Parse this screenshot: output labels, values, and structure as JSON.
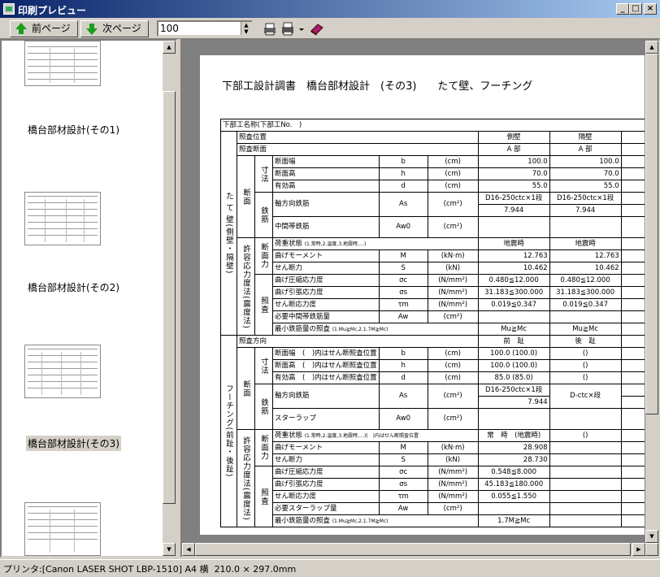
{
  "window": {
    "title": "印刷プレビュー",
    "min": "_",
    "max": "□",
    "close": "×"
  },
  "toolbar": {
    "prev_label": "前ページ",
    "next_label": "次ページ",
    "zoom_value": "100"
  },
  "thumbnails": [
    {
      "label": "橋台部材設計(その1)"
    },
    {
      "label": "橋台部材設計(その2)"
    },
    {
      "label": "橋台部材設計(その3)"
    }
  ],
  "page": {
    "title": "下部工設計調書　橋台部材設計　(その3)　　たて壁、フーチング",
    "header_name": "下部工名称(下部工No.　)",
    "wall_label": "た て 壁",
    "wall_sub": "(側壁・隔壁)",
    "footing_label": "フーチング",
    "footing_sub": "(前趾・後趾)",
    "dansen": "断面",
    "check": "許容応力度法(震度法)",
    "sunpo": "寸法",
    "tekkin": "鉄筋",
    "danmen_ryoku": "断面力",
    "shosa": "照査",
    "rows": {
      "pos": "照査位置",
      "sect": "照査断面",
      "side": "側壁",
      "partition": "隔壁",
      "a_bu": "A 部",
      "width": "断面幅",
      "height": "断面高",
      "eff": "有効高",
      "axial": "軸方向鉄筋",
      "mid": "中間帯鉄筋",
      "load": "荷重状態",
      "load_note": "(1.常時,2.温度,3.地震時,…)",
      "moment": "曲げモーメント",
      "shear": "せん断力",
      "comp": "曲げ圧縮応力度",
      "tens": "曲げ引張応力度",
      "shear_stress": "せん断応力度",
      "req_mid": "必要中間帯鉄筋量",
      "min_check": "最小鉄筋量の照査",
      "min_note": "(1.Mu≧Mc,2.1.7M≧Mc)",
      "dir": "照査方向",
      "front": "前　趾",
      "rear": "後　趾",
      "fw": "断面幅　(　)内はせん断照査位置",
      "fh": "断面高　(　)内はせん断照査位置",
      "fe": "有効高　(　)内はせん断照査位置",
      "stirrup": "スターラップ",
      "req_stirrup": "必要スターラップ量",
      "fload": "荷重状態",
      "fload_note": "(1.常時,2.温度,3.地震時,…)(　)内はせん断照査位置"
    },
    "sym": {
      "b": "b",
      "h": "h",
      "d": "d",
      "As": "As",
      "Aw0": "Aw0",
      "M": "M",
      "S": "S",
      "sc": "σc",
      "ss": "σs",
      "tm": "τm",
      "Aw": "Aw"
    },
    "unit": {
      "cm": "(cm)",
      "cm2": "(cm²)",
      "kNm": "(kN·m)",
      "kN": "(kN)",
      "nmm": "(N/mm²)"
    },
    "vals": {
      "w1": "100.0",
      "w2": "100.0",
      "h1": "70.0",
      "h2": "70.0",
      "d1": "55.0",
      "d2": "55.0",
      "as1": "D16-250ctc×1段",
      "as1b": "7.944",
      "as2": "D16-250ctc×1段",
      "as2b": "7.944",
      "l1": "地震時",
      "l2": "地震時",
      "m1": "12.763",
      "m2": "12.763",
      "s1": "10.462",
      "s2": "10.462",
      "c1": "0.480≦12.000",
      "c2": "0.480≦12.000",
      "t1": "31.183≦300.000",
      "t2": "31.183≦300.000",
      "tau1": "0.019≦0.347",
      "tau2": "0.019≦0.347",
      "mc1": "Mu≧Mc",
      "mc2": "Mu≧Mc",
      "fw1": "100.0 (100.0)",
      "fw2": "()",
      "fh1": "100.0 (100.0)",
      "fh2": "()",
      "fe1": "85.0 (85.0)",
      "fe2": "()",
      "fas1": "D16-250ctc×1段",
      "fas1b": "7.944",
      "fas2": "D-ctc×段",
      "fl1": "常　時　(地震時)",
      "fl2": "()",
      "fm1": "28.908",
      "fs1": "28.730",
      "fc1": "0.548≦8.000",
      "ft1": "45.183≦180.000",
      "ftau1": "0.055≦1.550",
      "fmc1": "1.7M≧Mc"
    }
  },
  "status": {
    "printer_prefix": "プリンタ:",
    "printer_name": "[Canon LASER SHOT LBP-1510]",
    "paper": "A4 横",
    "size": "210.0 × 297.0mm"
  }
}
